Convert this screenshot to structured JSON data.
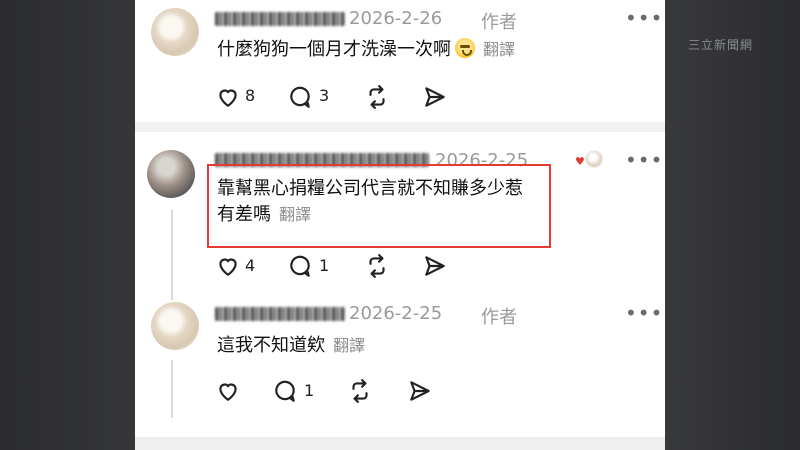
{
  "overlay": {
    "watermark": "三立新聞網"
  },
  "comments": [
    {
      "username": "",
      "date": "2026-2-26",
      "author_badge": "作者",
      "text": "什麼狗狗一個月才洗澡一次啊",
      "emoji": "scared-face-emoji",
      "translate": "翻譯",
      "likes": "8",
      "replies": "3"
    },
    {
      "username": "",
      "date": "2026-2-25",
      "text_line1": "靠幫黑心捐糧公司代言就不知賺多少惹",
      "text_line2": "有差嗎",
      "translate": "翻譯",
      "likes": "4",
      "replies": "1"
    },
    {
      "username": "",
      "date": "2026-2-25",
      "author_badge": "作者",
      "text": "這我不知道欸",
      "translate": "翻譯",
      "likes": "",
      "replies": "1"
    }
  ],
  "icons": {
    "like": "heart-icon",
    "reply": "comment-icon",
    "repost": "repost-icon",
    "share": "send-icon",
    "more": "more-icon"
  },
  "colors": {
    "highlight": "#e53935",
    "muted_text": "#9a9a9a",
    "body_text": "#111111"
  }
}
